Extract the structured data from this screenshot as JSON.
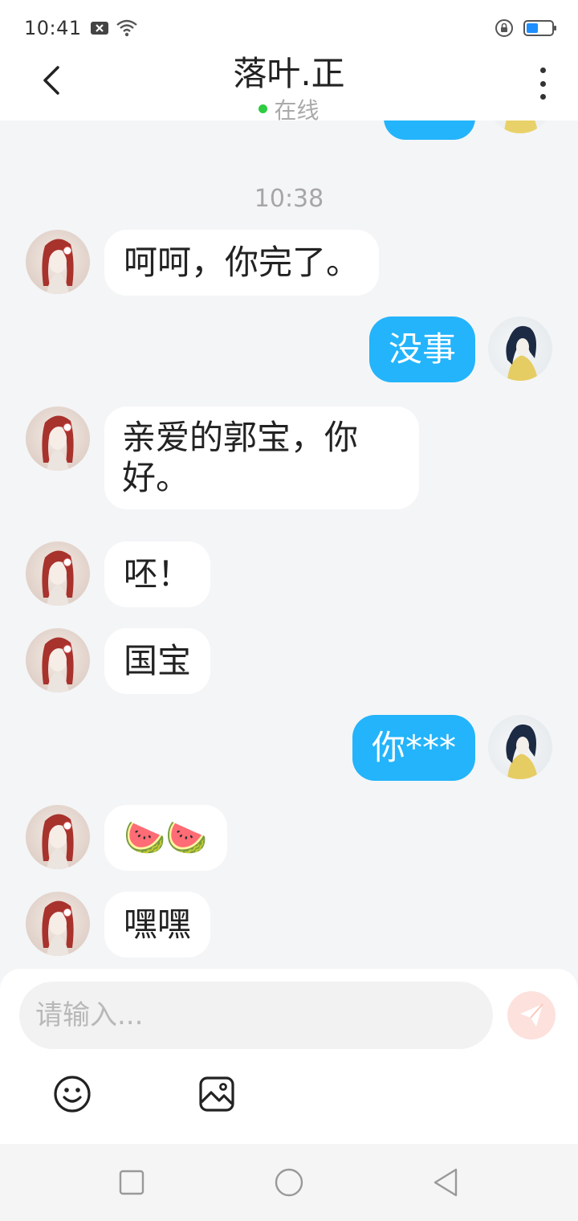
{
  "status_bar": {
    "time": "10:41",
    "icons": [
      "notification-x-icon",
      "wifi-icon",
      "rotation-lock-icon"
    ],
    "battery_level": 0.45,
    "battery_color": "#1e8fff"
  },
  "header": {
    "title": "落叶.正",
    "status": "在线",
    "status_color": "#2ecc40"
  },
  "conversation": {
    "timestamp": "10:38",
    "messages": [
      {
        "side": "left",
        "text": "呵呵，你完了。"
      },
      {
        "side": "right",
        "text": "没事"
      },
      {
        "side": "left",
        "text": "亲爱的郭宝，你好。"
      },
      {
        "side": "left",
        "text": "呸！"
      },
      {
        "side": "left",
        "text": "国宝"
      },
      {
        "side": "right",
        "text": "你***"
      },
      {
        "side": "left",
        "text": "🍉🍉"
      },
      {
        "side": "left",
        "text": "嘿嘿"
      }
    ],
    "outgoing_bubble_color": "#23b4fb",
    "incoming_bubble_color": "#ffffff"
  },
  "input": {
    "placeholder": "请输入...",
    "value": ""
  },
  "toolbar": {
    "icons": [
      "emoji-icon",
      "image-icon",
      "send-icon"
    ]
  },
  "nav_bar": {
    "icons": [
      "recent-apps-icon",
      "home-icon",
      "back-icon"
    ]
  }
}
